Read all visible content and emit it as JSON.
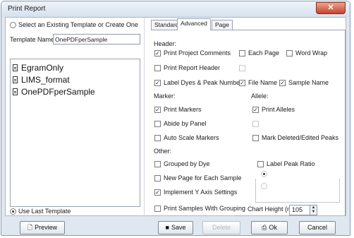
{
  "window": {
    "title": "Print Report",
    "close_glyph": "✕"
  },
  "left_panel": {
    "radio_select_existing": "Select an Existing Template or Create One",
    "template_name_label": "Template Name:",
    "template_name_value": "OnePDFperSample",
    "templates": [
      "EgramOnly",
      "LIMS_format",
      "OnePDFperSample"
    ],
    "use_last_template": "Use Last Template"
  },
  "tabs": [
    "Standard",
    "Advanced",
    "Page"
  ],
  "active_tab": "Advanced",
  "header": {
    "section": "Header:",
    "print_project_comments": "Print Project Comments",
    "each_page": "Each Page",
    "word_wrap": "Word Wrap",
    "print_report_header": "Print Report Header",
    "label_dyes_peak_numbers": "Label Dyes & Peak Numbers",
    "file_name": "File Name",
    "sample_name": "Sample Name"
  },
  "marker": {
    "section": "Marker:",
    "print_markers": "Print Markers",
    "abide_by_panel": "Abide by Panel",
    "auto_scale_markers": "Auto Scale Markers"
  },
  "allele": {
    "section": "Allele:",
    "print_alleles": "Print Alleles",
    "mark_deleted_edited_peaks": "Mark Deleted/Edited Peaks"
  },
  "other": {
    "section": "Other:",
    "grouped_by_dye": "Grouped by Dye",
    "new_page_each_sample": "New Page for Each Sample",
    "implement_y_axis": "Implement Y Axis Settings",
    "print_samples_grouping": "Print Samples With Grouping",
    "label_peak_ratio": "Label Peak Ratio",
    "chart_height_label": "Chart Height (mm)",
    "chart_height_value": "105"
  },
  "buttons": {
    "preview": "Preview",
    "save": "Save",
    "delete": "Delete",
    "ok": "Ok",
    "cancel": "Cancel"
  }
}
